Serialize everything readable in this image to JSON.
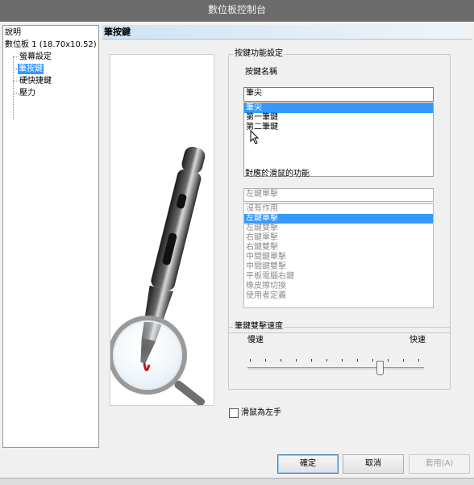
{
  "window": {
    "title": "數位板控制台"
  },
  "tree": {
    "items": [
      {
        "label": "說明"
      },
      {
        "label": "數位板 1 (18.70x10.52)"
      },
      {
        "label": "螢幕設定"
      },
      {
        "label": "筆按鍵"
      },
      {
        "label": "硬快捷鍵"
      },
      {
        "label": "壓力"
      }
    ],
    "selected_label": "筆按鍵"
  },
  "panel": {
    "title": "筆按鍵"
  },
  "button_settings": {
    "group_label": "按鍵功能設定",
    "name_label": "按鍵名稱",
    "name_value": "筆尖",
    "buttons": [
      "筆尖",
      "第一筆鍵",
      "第二筆鍵"
    ],
    "selected_button": "筆尖"
  },
  "mouse_function": {
    "label": "對應於滑鼠的功能",
    "value": "左鍵單擊",
    "options": [
      "沒有作用",
      "左鍵單擊",
      "左鍵雙擊",
      "右鍵單擊",
      "右鍵雙擊",
      "中間鍵單擊",
      "中間鍵雙擊",
      "平板電腦右鍵",
      "橡皮擦切換",
      "使用者定義"
    ],
    "selected_option": "左鍵單擊"
  },
  "double_click_speed": {
    "group_label": "筆鍵雙擊速度",
    "slow_label": "慢速",
    "fast_label": "快速",
    "value_fraction": 0.75
  },
  "left_handed": {
    "label": "滑鼠為左手",
    "checked": false
  },
  "dialog_buttons": {
    "ok": "確定",
    "cancel": "取消",
    "apply": "套用(A)"
  },
  "colors": {
    "selection": "#3399ff",
    "titlebar": "#6b6b6b",
    "header_gradient": "#cde3f5"
  }
}
